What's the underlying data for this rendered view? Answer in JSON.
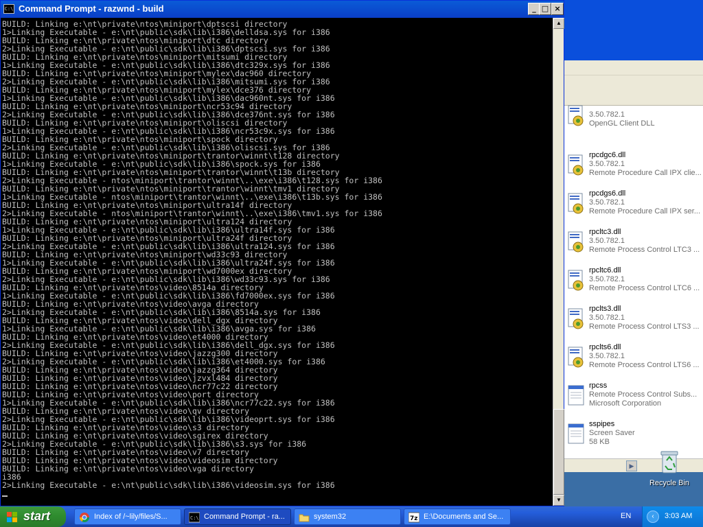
{
  "cmd_window": {
    "title": "Command Prompt - razwnd - build",
    "icon_text": "C:\\"
  },
  "console_lines": [
    "BUILD: Linking e:\\nt\\private\\ntos\\miniport\\dptscsi directory",
    "1>Linking Executable - e:\\nt\\public\\sdk\\lib\\i386\\delldsa.sys for i386",
    "BUILD: Linking e:\\nt\\private\\ntos\\miniport\\dtc directory",
    "2>Linking Executable - e:\\nt\\public\\sdk\\lib\\i386\\dptscsi.sys for i386",
    "BUILD: Linking e:\\nt\\private\\ntos\\miniport\\mitsumi directory",
    "1>Linking Executable - e:\\nt\\public\\sdk\\lib\\i386\\dtc329x.sys for i386",
    "BUILD: Linking e:\\nt\\private\\ntos\\miniport\\mylex\\dac960 directory",
    "2>Linking Executable - e:\\nt\\public\\sdk\\lib\\i386\\mitsumi.sys for i386",
    "BUILD: Linking e:\\nt\\private\\ntos\\miniport\\mylex\\dce376 directory",
    "1>Linking Executable - e:\\nt\\public\\sdk\\lib\\i386\\dac960nt.sys for i386",
    "BUILD: Linking e:\\nt\\private\\ntos\\miniport\\ncr53c94 directory",
    "2>Linking Executable - e:\\nt\\public\\sdk\\lib\\i386\\dce376nt.sys for i386",
    "BUILD: Linking e:\\nt\\private\\ntos\\miniport\\oliscsi directory",
    "1>Linking Executable - e:\\nt\\public\\sdk\\lib\\i386\\ncr53c9x.sys for i386",
    "BUILD: Linking e:\\nt\\private\\ntos\\miniport\\spock directory",
    "2>Linking Executable - e:\\nt\\public\\sdk\\lib\\i386\\oliscsi.sys for i386",
    "BUILD: Linking e:\\nt\\private\\ntos\\miniport\\trantor\\winnt\\t128 directory",
    "1>Linking Executable - e:\\nt\\public\\sdk\\lib\\i386\\spock.sys for i386",
    "BUILD: Linking e:\\nt\\private\\ntos\\miniport\\trantor\\winnt\\t13b directory",
    "2>Linking Executable - ntos\\miniport\\trantor\\winnt\\..\\exe\\i386\\t128.sys for i386",
    "BUILD: Linking e:\\nt\\private\\ntos\\miniport\\trantor\\winnt\\tmv1 directory",
    "1>Linking Executable - ntos\\miniport\\trantor\\winnt\\..\\exe\\i386\\t13b.sys for i386",
    "BUILD: Linking e:\\nt\\private\\ntos\\miniport\\ultra14f directory",
    "2>Linking Executable - ntos\\miniport\\trantor\\winnt\\..\\exe\\i386\\tmv1.sys for i386",
    "BUILD: Linking e:\\nt\\private\\ntos\\miniport\\ultra124 directory",
    "1>Linking Executable - e:\\nt\\public\\sdk\\lib\\i386\\ultra14f.sys for i386",
    "BUILD: Linking e:\\nt\\private\\ntos\\miniport\\ultra24f directory",
    "2>Linking Executable - e:\\nt\\public\\sdk\\lib\\i386\\ultra124.sys for i386",
    "BUILD: Linking e:\\nt\\private\\ntos\\miniport\\wd33c93 directory",
    "1>Linking Executable - e:\\nt\\public\\sdk\\lib\\i386\\ultra24f.sys for i386",
    "BUILD: Linking e:\\nt\\private\\ntos\\miniport\\wd7000ex directory",
    "2>Linking Executable - e:\\nt\\public\\sdk\\lib\\i386\\wd33c93.sys for i386",
    "BUILD: Linking e:\\nt\\private\\ntos\\video\\8514a directory",
    "1>Linking Executable - e:\\nt\\public\\sdk\\lib\\i386\\fd7000ex.sys for i386",
    "BUILD: Linking e:\\nt\\private\\ntos\\video\\avga directory",
    "2>Linking Executable - e:\\nt\\public\\sdk\\lib\\i386\\8514a.sys for i386",
    "BUILD: Linking e:\\nt\\private\\ntos\\video\\dell_dgx directory",
    "1>Linking Executable - e:\\nt\\public\\sdk\\lib\\i386\\avga.sys for i386",
    "BUILD: Linking e:\\nt\\private\\ntos\\video\\et4000 directory",
    "2>Linking Executable - e:\\nt\\public\\sdk\\lib\\i386\\dell_dgx.sys for i386",
    "BUILD: Linking e:\\nt\\private\\ntos\\video\\jazzg300 directory",
    "2>Linking Executable - e:\\nt\\public\\sdk\\lib\\i386\\et4000.sys for i386",
    "BUILD: Linking e:\\nt\\private\\ntos\\video\\jazzg364 directory",
    "BUILD: Linking e:\\nt\\private\\ntos\\video\\jzvxl484 directory",
    "BUILD: Linking e:\\nt\\private\\ntos\\video\\ncr77c22 directory",
    "BUILD: Linking e:\\nt\\private\\ntos\\video\\port directory",
    "1>Linking Executable - e:\\nt\\public\\sdk\\lib\\i386\\ncr77c22.sys for i386",
    "BUILD: Linking e:\\nt\\private\\ntos\\video\\qv directory",
    "2>Linking Executable - e:\\nt\\public\\sdk\\lib\\i386\\videoprt.sys for i386",
    "BUILD: Linking e:\\nt\\private\\ntos\\video\\s3 directory",
    "BUILD: Linking e:\\nt\\private\\ntos\\video\\sgirex directory",
    "2>Linking Executable - e:\\nt\\public\\sdk\\lib\\i386\\s3.sys for i386",
    "BUILD: Linking e:\\nt\\private\\ntos\\video\\v7 directory",
    "BUILD: Linking e:\\nt\\private\\ntos\\video\\videosim directory",
    "BUILD: Linking e:\\nt\\private\\ntos\\video\\vga directory",
    "i386",
    "2>Linking Executable - e:\\nt\\public\\sdk\\lib\\i386\\videosim.sys for i386"
  ],
  "explorer": {
    "files": [
      {
        "name": "",
        "version": "3.50.782.1",
        "description": "OpenGL Client DLL",
        "extra": ""
      },
      {
        "name": "rpcdgc6.dll",
        "version": "3.50.782.1",
        "description": "Remote Procedure Call IPX clie...",
        "extra": ""
      },
      {
        "name": "rpcdgs6.dll",
        "version": "3.50.782.1",
        "description": "Remote Procedure Call IPX ser...",
        "extra": ""
      },
      {
        "name": "rpcltc3.dll",
        "version": "3.50.782.1",
        "description": "Remote Process Control LTC3 ...",
        "extra": ""
      },
      {
        "name": "rpcltc6.dll",
        "version": "3.50.782.1",
        "description": "Remote Process Control LTC6 ...",
        "extra": ""
      },
      {
        "name": "rpclts3.dll",
        "version": "3.50.782.1",
        "description": "Remote Process Control LTS3 ...",
        "extra": ""
      },
      {
        "name": "rpclts6.dll",
        "version": "3.50.782.1",
        "description": "Remote Process Control LTS6 ...",
        "extra": ""
      },
      {
        "name": "rpcss",
        "version": "Remote Process Control Subs...",
        "description": "Microsoft Corporation",
        "extra": ""
      },
      {
        "name": "sspipes",
        "version": "Screen Saver",
        "description": "58 KB",
        "extra": ""
      }
    ]
  },
  "desktop": {
    "recycle_bin_label": "Recycle Bin"
  },
  "taskbar": {
    "start_label": "start",
    "tasks": [
      {
        "label": "Index of /~lily/files/S...",
        "icon": "chrome-icon"
      },
      {
        "label": "Command Prompt - ra...",
        "icon": "cmd-icon"
      },
      {
        "label": "system32",
        "icon": "folder-icon"
      },
      {
        "label": "E:\\Documents and Se...",
        "icon": "editor-icon"
      }
    ],
    "language": "EN",
    "clock": "3:03 AM"
  }
}
